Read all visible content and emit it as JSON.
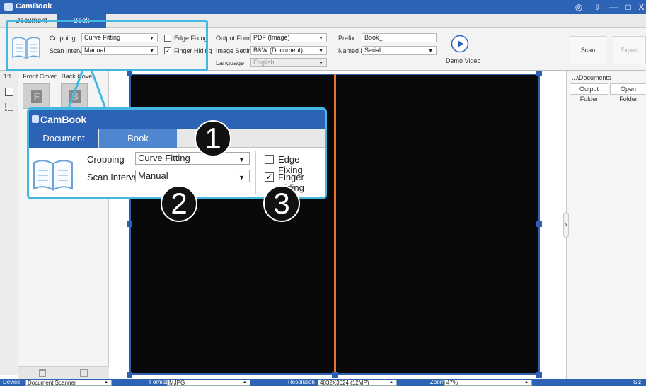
{
  "app": {
    "title": "CamBook",
    "window_controls": [
      "◎",
      "⇩",
      "—",
      "□",
      "X"
    ]
  },
  "tabs": [
    {
      "label": "Document"
    },
    {
      "label": "Book"
    }
  ],
  "ribbon": {
    "cropping_label": "Cropping",
    "cropping_value": "Curve Fitting",
    "scan_interval_label": "Scan Interval",
    "scan_interval_value": "Manual",
    "edge_fixing_label": "Edge Fixing",
    "edge_fixing_checked": false,
    "finger_hiding_label": "Finger Hiding",
    "finger_hiding_checked": true,
    "output_format_label": "Output Format",
    "output_format_value": "PDF (Image)",
    "image_settings_label": "Image Settings",
    "image_settings_value": "B&W (Document)",
    "language_label": "Language",
    "language_value": "English",
    "prefix_label": "Prefix",
    "prefix_value": "Book_",
    "named_by_label": "Named By",
    "named_by_value": "Serial",
    "demo_video_label": "Demo Video",
    "scan_label": "Scan",
    "export_label": "Export"
  },
  "side_tools": {
    "ratio_label": "1:1"
  },
  "thumbnails": {
    "front_cover_label": "Front Cover",
    "back_cover_label": "Back Cover",
    "front_letter": "F",
    "back_letter": "B"
  },
  "right_panel": {
    "path_label": "...\\Documents",
    "output_folder_label": "Output Folder",
    "open_folder_label": "Open Folder"
  },
  "status": {
    "device_label": "Device",
    "device_value": "Document Scanner",
    "format_label": "Format",
    "format_value": "MJPG",
    "resolution_label": "Resolution",
    "resolution_value": "4032X3024 (12MP)",
    "zoom_label": "Zoom",
    "zoom_value": "47%",
    "size_label": "Siz"
  },
  "zoom_view": {
    "title": "CamBook",
    "tab_document": "Document",
    "tab_book": "Book",
    "cropping_label": "Cropping",
    "cropping_value": "Curve Fitting",
    "scan_interval_label": "Scan Interval",
    "scan_interval_value": "Manual",
    "edge_fixing_label": "Edge Fixing",
    "finger_hiding_label": "Finger Hiding"
  },
  "callouts": [
    "1",
    "2",
    "3"
  ],
  "colors": {
    "accent": "#2d63b4",
    "highlight": "#44b7e2",
    "split_line": "#e8742a",
    "canvas": "#090909"
  }
}
